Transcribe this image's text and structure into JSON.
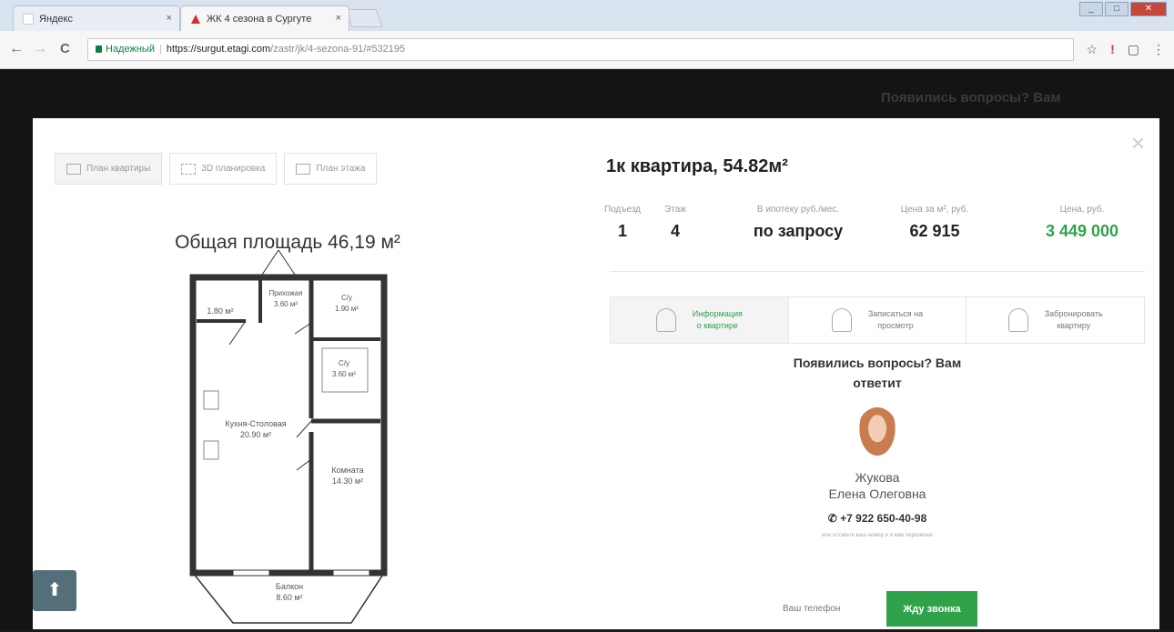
{
  "browser": {
    "tabs": [
      {
        "title": "Яндекс",
        "close": "×"
      },
      {
        "title": "ЖК 4 сезона в Сургуте",
        "close": "×"
      }
    ],
    "window_buttons": [
      "_",
      "□",
      "✕"
    ],
    "nav": {
      "back": "←",
      "forward": "→",
      "reload": "C"
    },
    "security_label": "Надежный",
    "url_host": "https://surgut.etagi.com",
    "url_path": "/zastr/jk/4-sezona-91/#532195",
    "toolbar_icons": [
      "☆",
      "!",
      "▢",
      "⋮"
    ]
  },
  "site_bg": {
    "ghost_text": "Появились вопросы? Вам"
  },
  "modal": {
    "close": "×",
    "plan_tabs": [
      {
        "label": "План квартиры",
        "icon": "floorplan-icon"
      },
      {
        "label": "3D планировка",
        "icon": "3d-icon"
      },
      {
        "label": "План этажа",
        "icon": "floor-icon"
      }
    ],
    "area_title": "Общая площадь 46,19 м²",
    "plan_rooms": [
      {
        "name": "",
        "area": "1.80 м²"
      },
      {
        "name": "Прихожая",
        "area": "3.60 м²"
      },
      {
        "name": "С/у",
        "area": "1.90 м²"
      },
      {
        "name": "С/у",
        "area": "3.60 м²"
      },
      {
        "name": "Кухня-Столовая",
        "area": "20.90 м²"
      },
      {
        "name": "Комната",
        "area": "14.30 м²"
      },
      {
        "name": "Балкон",
        "area": "8.60 м²"
      }
    ],
    "back_to_top": "⬆",
    "apartment": {
      "title": "1к квартира, 54.82м²",
      "stats": [
        {
          "label": "Подъезд",
          "value": "1"
        },
        {
          "label": "Этаж",
          "value": "4"
        },
        {
          "label": "В ипотеку руб./мес.",
          "value": "по запросу"
        },
        {
          "label": "Цена за м², руб.",
          "value": "62 915"
        },
        {
          "label": "Цена, руб.",
          "value": "3 449 000"
        }
      ],
      "price_color": "#2fa24a"
    },
    "info_tabs": [
      {
        "line1": "Информация",
        "line2": "о квартире",
        "icon": "person-icon"
      },
      {
        "line1": "Записаться на",
        "line2": "просмотр",
        "icon": "hand-icon"
      },
      {
        "line1": "Забронировать",
        "line2": "квартиру",
        "icon": "lock-icon"
      }
    ],
    "contact": {
      "question": "Появились вопросы? Вам ответит",
      "agent_surname": "Жукова",
      "agent_name": "Елена Олеговна",
      "phone": "+7 922 650-40-98",
      "hint": "или оставьте ваш номер и я вам перезвоню",
      "phone_placeholder": "Ваш телефон",
      "callback_button": "Жду звонка"
    }
  }
}
